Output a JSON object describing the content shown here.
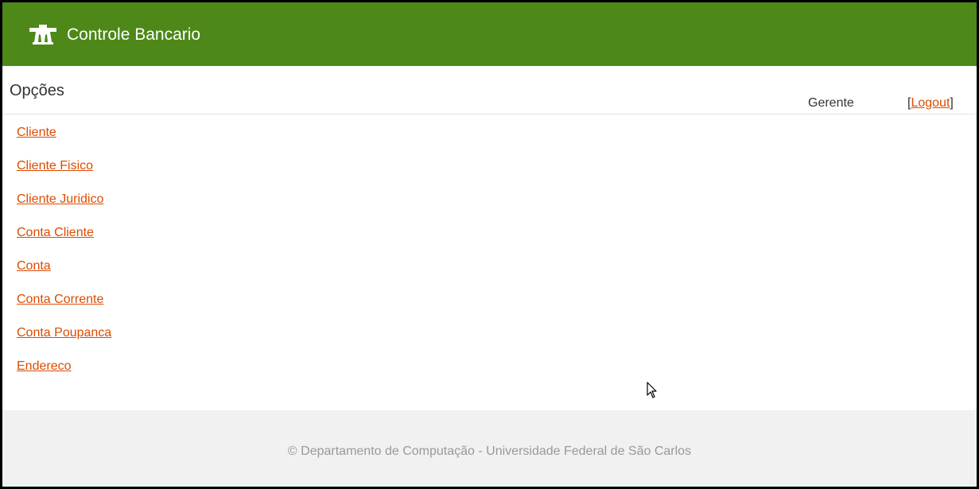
{
  "header": {
    "app_title": "Controle Bancario",
    "logo_icon": "bank-logo-icon",
    "background_color": "#4d8818"
  },
  "main": {
    "options_title": "Opções",
    "user_role": "Gerente",
    "logout_open_bracket": "[",
    "logout_label": "Logout",
    "logout_close_bracket": "]",
    "link_color": "#dd4b00",
    "menu_items": [
      {
        "label": "Cliente"
      },
      {
        "label": "Cliente Fisico"
      },
      {
        "label": "Cliente Juridico"
      },
      {
        "label": "Conta Cliente"
      },
      {
        "label": "Conta"
      },
      {
        "label": "Conta Corrente"
      },
      {
        "label": "Conta Poupanca"
      },
      {
        "label": "Endereco"
      }
    ]
  },
  "footer": {
    "text": "© Departamento de Computação - Universidade Federal de São Carlos"
  }
}
